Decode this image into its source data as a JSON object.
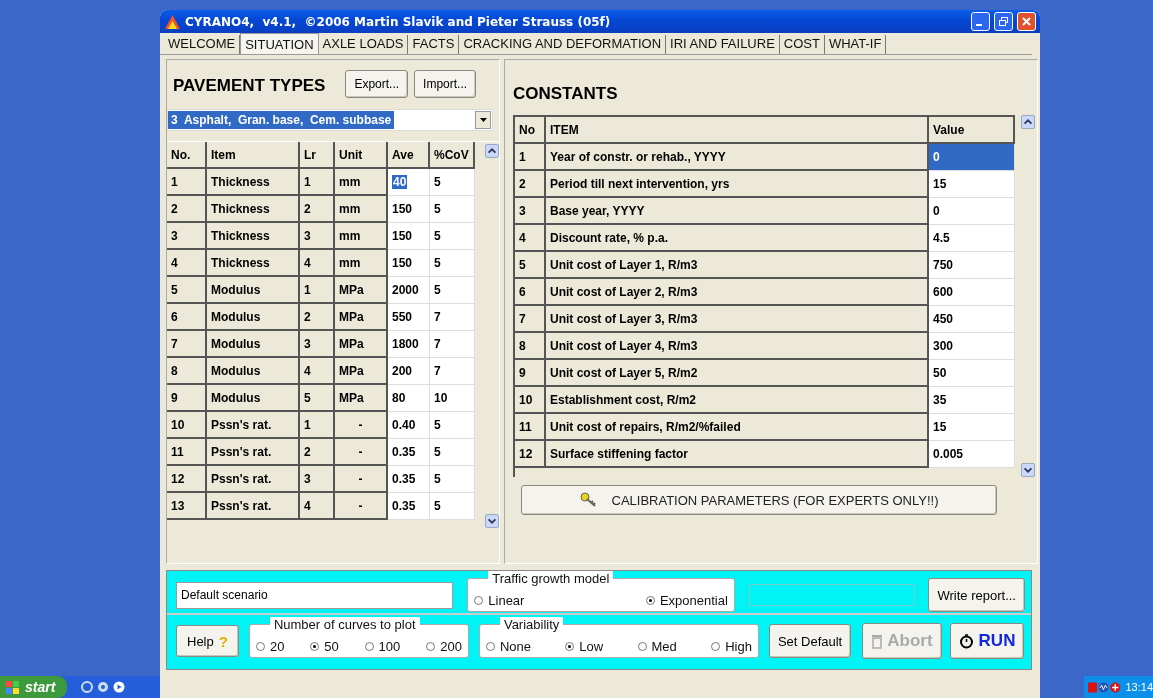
{
  "window": {
    "title": "CYRANO4,  v4.1,  ©2006 Martin Slavik and Pieter Strauss (05f)"
  },
  "tabs": [
    {
      "label": "WELCOME",
      "selected": false
    },
    {
      "label": "SITUATION",
      "selected": true
    },
    {
      "label": "AXLE LOADS",
      "selected": false
    },
    {
      "label": "FACTS",
      "selected": false
    },
    {
      "label": "CRACKING AND DEFORMATION",
      "selected": false
    },
    {
      "label": "IRI AND FAILURE",
      "selected": false
    },
    {
      "label": "COST",
      "selected": false
    },
    {
      "label": "WHAT-IF",
      "selected": false
    }
  ],
  "pavement_types": {
    "heading": "PAVEMENT TYPES",
    "buttons": [
      "Export...",
      "Import..."
    ],
    "selected_type": "3  Asphalt,  Gran. base,  Cem. subbase",
    "table": {
      "columns": [
        "No.",
        "Item",
        "Lr",
        "Unit",
        "Ave",
        "%CoV"
      ],
      "rows": [
        {
          "cells": [
            "1",
            "Thickness",
            "1",
            "mm",
            "40",
            "5"
          ],
          "selected": true
        },
        {
          "cells": [
            "2",
            "Thickness",
            "2",
            "mm",
            "150",
            "5"
          ],
          "selected": false
        },
        {
          "cells": [
            "3",
            "Thickness",
            "3",
            "mm",
            "150",
            "5"
          ],
          "selected": false
        },
        {
          "cells": [
            "4",
            "Thickness",
            "4",
            "mm",
            "150",
            "5"
          ],
          "selected": false
        },
        {
          "cells": [
            "5",
            "Modulus",
            "1",
            "MPa",
            "2000",
            "5"
          ],
          "selected": false
        },
        {
          "cells": [
            "6",
            "Modulus",
            "2",
            "MPa",
            "550",
            "7"
          ],
          "selected": false
        },
        {
          "cells": [
            "7",
            "Modulus",
            "3",
            "MPa",
            "1800",
            "7"
          ],
          "selected": false
        },
        {
          "cells": [
            "8",
            "Modulus",
            "4",
            "MPa",
            "200",
            "7"
          ],
          "selected": false
        },
        {
          "cells": [
            "9",
            "Modulus",
            "5",
            "MPa",
            "80",
            "10"
          ],
          "selected": false
        },
        {
          "cells": [
            "10",
            "Pssn's rat.",
            "1",
            "-",
            "0.40",
            "5"
          ],
          "selected": false
        },
        {
          "cells": [
            "11",
            "Pssn's rat.",
            "2",
            "-",
            "0.35",
            "5"
          ],
          "selected": false
        },
        {
          "cells": [
            "12",
            "Pssn's rat.",
            "3",
            "-",
            "0.35",
            "5"
          ],
          "selected": false
        },
        {
          "cells": [
            "13",
            "Pssn's rat.",
            "4",
            "-",
            "0.35",
            "5"
          ],
          "selected": false
        }
      ]
    }
  },
  "constants": {
    "heading": "CONSTANTS",
    "columns": [
      "No",
      "ITEM",
      "Value"
    ],
    "rows": [
      {
        "cells": [
          "1",
          "Year of constr. or rehab., YYYY",
          "0"
        ],
        "selected": true
      },
      {
        "cells": [
          "2",
          "Period till next intervention, yrs",
          "15"
        ],
        "selected": false
      },
      {
        "cells": [
          "3",
          "Base year, YYYY",
          "0"
        ],
        "selected": false
      },
      {
        "cells": [
          "4",
          "Discount rate, % p.a.",
          "4.5"
        ],
        "selected": false
      },
      {
        "cells": [
          "5",
          "Unit cost of Layer 1, R/m3",
          "750"
        ],
        "selected": false
      },
      {
        "cells": [
          "6",
          "Unit cost of Layer 2, R/m3",
          "600"
        ],
        "selected": false
      },
      {
        "cells": [
          "7",
          "Unit cost of Layer 3, R/m3",
          "450"
        ],
        "selected": false
      },
      {
        "cells": [
          "8",
          "Unit cost of Layer 4, R/m3",
          "300"
        ],
        "selected": false
      },
      {
        "cells": [
          "9",
          "Unit cost of Layer 5, R/m2",
          "50"
        ],
        "selected": false
      },
      {
        "cells": [
          "10",
          "Establishment cost, R/m2",
          "35"
        ],
        "selected": false
      },
      {
        "cells": [
          "11",
          "Unit cost of repairs, R/m2/%failed",
          "15"
        ],
        "selected": false
      },
      {
        "cells": [
          "12",
          "Surface stiffening factor",
          "0.005"
        ],
        "selected": false
      }
    ],
    "calibration_button": "CALIBRATION PARAMETERS (FOR EXPERTS ONLY!!)"
  },
  "scenario_field": {
    "value": "Default scenario"
  },
  "traffic_growth_model": {
    "label": "Traffic growth model",
    "options": [
      {
        "label": "Linear",
        "selected": false
      },
      {
        "label": "Exponential",
        "selected": true
      }
    ]
  },
  "write_report_button": {
    "label": "Write report..."
  },
  "help_button": {
    "label": "Help",
    "mark": "?"
  },
  "curves_to_plot": {
    "label": "Number of curves to plot",
    "options": [
      {
        "label": "20",
        "selected": false
      },
      {
        "label": "50",
        "selected": true
      },
      {
        "label": "100",
        "selected": false
      },
      {
        "label": "200",
        "selected": false
      }
    ]
  },
  "variability": {
    "label": "Variability",
    "options": [
      {
        "label": "None",
        "selected": false
      },
      {
        "label": "Low",
        "selected": true
      },
      {
        "label": "Med",
        "selected": false
      },
      {
        "label": "High",
        "selected": false
      }
    ]
  },
  "set_default_button": {
    "label": "Set Default"
  },
  "abort_button": {
    "label": "Abort",
    "disabled": true
  },
  "run_button": {
    "label": "RUN"
  },
  "taskbar": {
    "start": "start",
    "clock": "13:14"
  }
}
